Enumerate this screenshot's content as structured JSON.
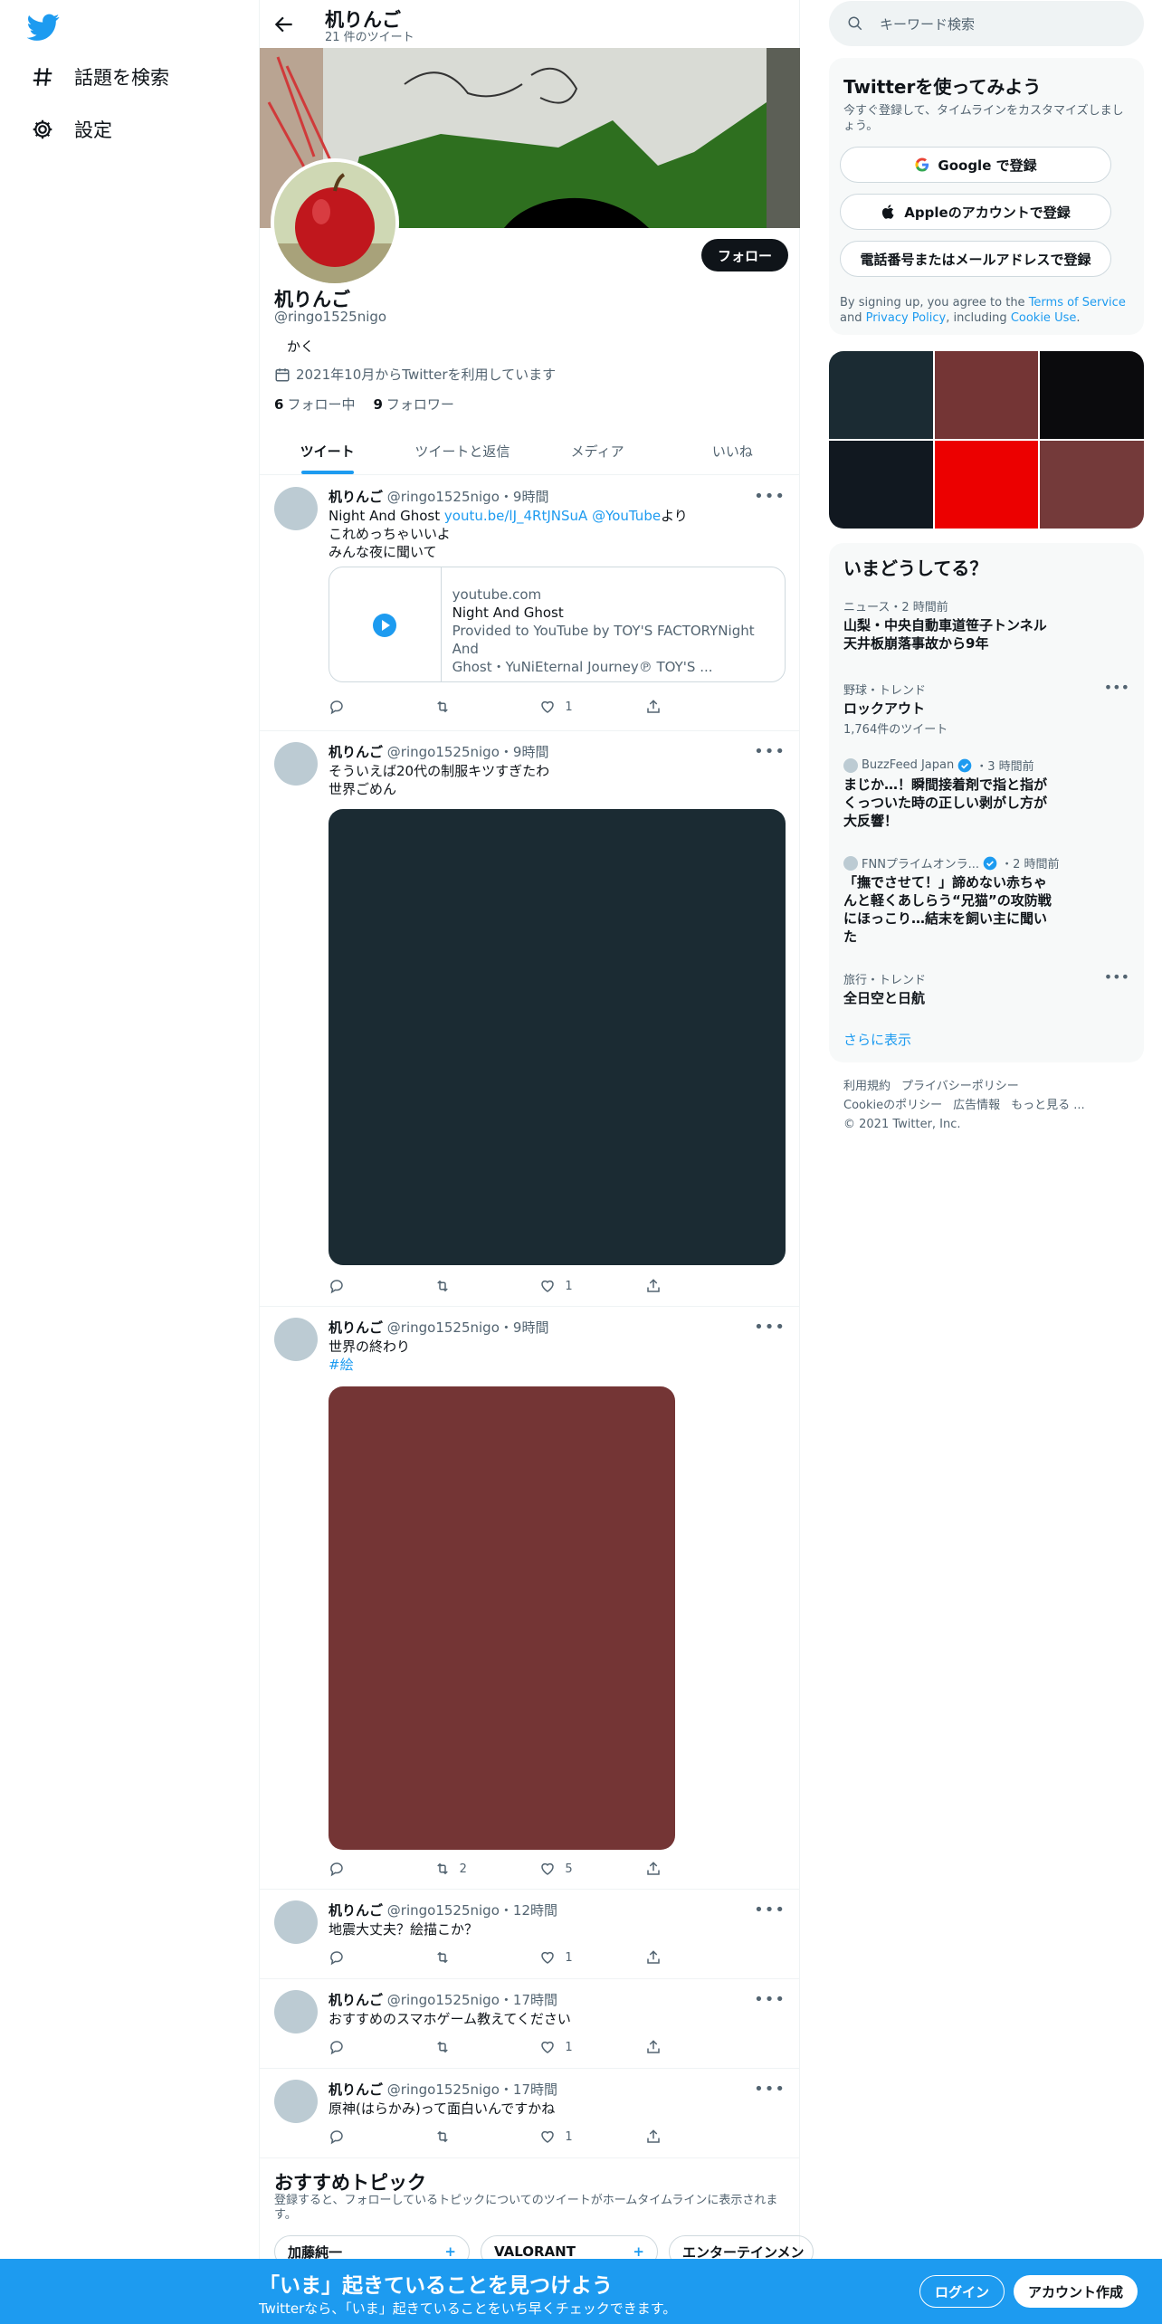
{
  "nav": {
    "items": [
      {
        "label": "話題を検索",
        "icon": "hashtag-icon"
      },
      {
        "label": "設定",
        "icon": "gear-icon"
      }
    ]
  },
  "header": {
    "name": "机りんご",
    "tweet_count": "21 件のツイート"
  },
  "profile": {
    "name": "机りんご",
    "handle": "@ringo1525nigo",
    "bio": "かく",
    "joined": "2021年10月からTwitterを利用しています",
    "following_count": "6",
    "following_label": "フォロー中",
    "followers_count": "9",
    "followers_label": "フォロワー",
    "follow_button": "フォロー"
  },
  "tabs": [
    "ツイート",
    "ツイートと返信",
    "メディア",
    "いいね"
  ],
  "tweets": [
    {
      "name": "机りんご",
      "handle": "@ringo1525nigo",
      "time": "9時間",
      "line1_prefix": "Night And Ghost ",
      "line1_link": "youtu.be/lJ_4RtJNSuA @YouTube",
      "line1_suffix": "より",
      "line2": "これめっちゃいいよ",
      "line3": "みんな夜に聞いて",
      "card": {
        "domain": "youtube.com",
        "title": "Night And Ghost",
        "desc1": "Provided to YouTube by TOY'S FACTORYNight And",
        "desc2": "Ghost・YuNiEternal Journey℗ TOY'S ..."
      },
      "retweets": "",
      "likes": "1"
    },
    {
      "name": "机りんご",
      "handle": "@ringo1525nigo",
      "time": "9時間",
      "line1": "そういえば20代の制服キツすぎたわ",
      "line2": "世界ごめん",
      "media_color": "#1b2b33",
      "retweets": "",
      "likes": "1"
    },
    {
      "name": "机りんご",
      "handle": "@ringo1525nigo",
      "time": "9時間",
      "line1": "世界の終わり",
      "hashtag": "#絵",
      "media_color": "#743535",
      "retweets": "2",
      "likes": "5"
    },
    {
      "name": "机りんご",
      "handle": "@ringo1525nigo",
      "time": "12時間",
      "line1": "地震大丈夫？絵描こか？",
      "retweets": "",
      "likes": "1"
    },
    {
      "name": "机りんご",
      "handle": "@ringo1525nigo",
      "time": "17時間",
      "line1": "おすすめのスマホゲーム教えてください",
      "retweets": "",
      "likes": "1"
    },
    {
      "name": "机りんご",
      "handle": "@ringo1525nigo",
      "time": "17時間",
      "line1": "原神(はらかみ)って面白いんですかね",
      "retweets": "",
      "likes": "1"
    }
  ],
  "topics": {
    "title": "おすすめトピック",
    "desc": "登録すると、フォローしているトピックについてのツイートがホームタイムラインに表示されます。",
    "chips": [
      "加藤純一",
      "VALORANT",
      "エンターテインメン"
    ]
  },
  "search": {
    "placeholder": "キーワード検索"
  },
  "signup": {
    "title": "Twitterを使ってみよう",
    "subtitle": "今すぐ登録して、タイムラインをカスタマイズしましょう。",
    "google": "Google で登録",
    "apple": "Appleのアカウントで登録",
    "phone": "電話番号またはメールアドレスで登録",
    "terms_prefix": "By signing up, you agree to the ",
    "terms_link": "Terms of Service",
    "terms_and": " and ",
    "privacy_link": "Privacy Policy",
    "terms_including": ", including ",
    "cookie_link": "Cookie Use",
    "terms_end": "."
  },
  "media_grid": [
    "#1b2b33",
    "#743535",
    "#0b0b0d",
    "#111820",
    "#ec0000",
    "#743a3a"
  ],
  "trends": {
    "title": "いまどうしてる？",
    "items": [
      {
        "meta": "ニュース・2 時間前",
        "name1": "山梨・中央自動車道笹子トンネル",
        "name2": "天井板崩落事故から9年"
      },
      {
        "meta": "野球・トレンド",
        "name1": "ロックアウト",
        "tweets": "1,764件のツイート"
      },
      {
        "source": "BuzzFeed Japan",
        "time": "・3 時間前",
        "name1": "まじか…！瞬間接着剤で指と指が",
        "name2": "くっついた時の正しい剥がし方が",
        "name3": "大反響！"
      },
      {
        "source": "FNNプライムオンラ...",
        "time": "・2 時間前",
        "name1": "「撫でさせて！」諦めない赤ちゃ",
        "name2": "んと軽くあしらう“兄猫”の攻防戦",
        "name3": "にほっこり…結末を飼い主に聞い",
        "name4": "た"
      },
      {
        "meta": "旅行・トレンド",
        "name1": "全日空と日航"
      }
    ],
    "show_more": "さらに表示"
  },
  "footer": {
    "terms": "利用規約",
    "privacy": "プライバシーポリシー",
    "cookie": "Cookieのポリシー",
    "ads": "広告情報",
    "more": "もっと見る ...",
    "copyright": "© 2021 Twitter, Inc."
  },
  "bottombar": {
    "title": "「いま」起きていることを見つけよう",
    "subtitle": "Twitterなら、「いま」起きていることをいち早くチェックできます。",
    "login": "ログイン",
    "signup": "アカウント作成"
  },
  "colors": {
    "accent": "#1d9bf0",
    "text": "#0f1419",
    "muted": "#536471"
  }
}
